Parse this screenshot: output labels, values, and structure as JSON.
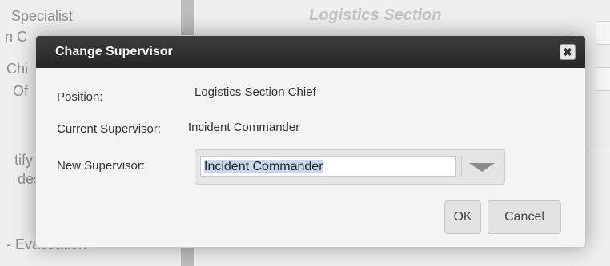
{
  "background": {
    "left_items": [
      "Specialist",
      "n C",
      "Chi",
      "Of",
      "tify",
      "des",
      "- Evacuation"
    ],
    "section_title": "Logistics Section",
    "close_label": "close"
  },
  "dialog": {
    "title": "Change Supervisor",
    "close_glyph": "✖",
    "position_label": "Position:",
    "position_value": "Logistics Section Chief",
    "current_supervisor_label": "Current Supervisor:",
    "current_supervisor_value": "Incident Commander",
    "new_supervisor_label": "New Supervisor:",
    "new_supervisor_selected": "Incident Commander",
    "ok_label": "OK",
    "cancel_label": "Cancel"
  }
}
